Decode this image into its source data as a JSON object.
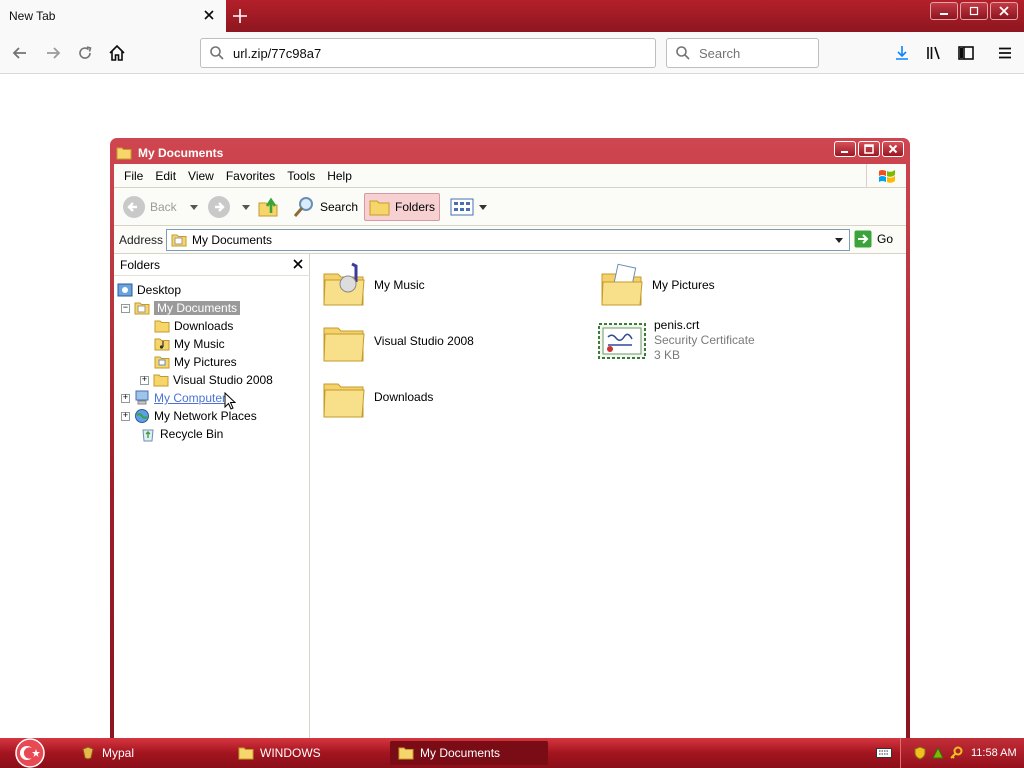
{
  "browser": {
    "tab_title": "New Tab",
    "url": "url.zip/77c98a7",
    "search_placeholder": "Search"
  },
  "window": {
    "title": "My Documents",
    "menu": [
      "File",
      "Edit",
      "View",
      "Favorites",
      "Tools",
      "Help"
    ],
    "toolbar": {
      "back": "Back",
      "search": "Search",
      "folders": "Folders"
    },
    "address": {
      "label": "Address",
      "value": "My Documents",
      "go": "Go"
    }
  },
  "folders_pane": {
    "title": "Folders",
    "tree": [
      {
        "label": "Desktop"
      },
      {
        "label": "My Documents"
      },
      {
        "label": "Downloads"
      },
      {
        "label": "My Music"
      },
      {
        "label": "My Pictures"
      },
      {
        "label": "Visual Studio 2008"
      },
      {
        "label": "My Computer"
      },
      {
        "label": "My Network Places"
      },
      {
        "label": "Recycle Bin"
      }
    ]
  },
  "content": {
    "items": [
      {
        "name": "My Music"
      },
      {
        "name": "My Pictures"
      },
      {
        "name": "Visual Studio 2008"
      },
      {
        "name": "penis.crt",
        "type": "Security Certificate",
        "size": "3 KB"
      },
      {
        "name": "Downloads"
      }
    ]
  },
  "taskbar": {
    "tasks": [
      "Mypal",
      "WINDOWS",
      "My Documents"
    ],
    "clock": "11:58 AM"
  },
  "colors": {
    "theme_red": "#a3141f",
    "selection_gray": "#9a9a9a",
    "link_blue": "#4b74d6"
  }
}
